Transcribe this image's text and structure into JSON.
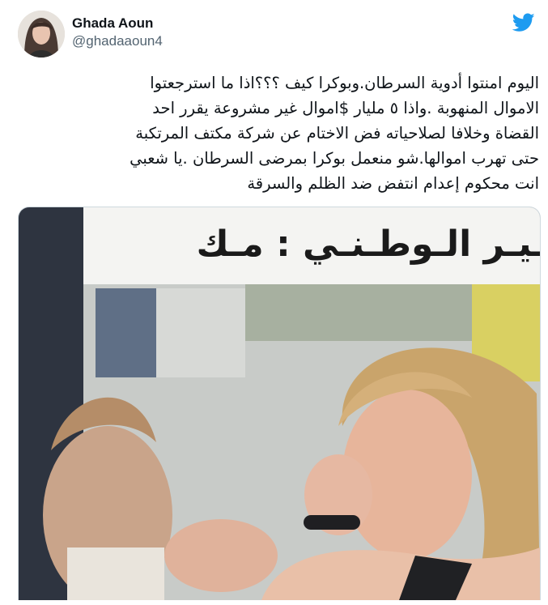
{
  "author": {
    "display_name": "Ghada Aoun",
    "handle": "@ghadaaoun4"
  },
  "icons": {
    "brand": "twitter-bird-icon",
    "brand_color": "#1d9bf0"
  },
  "tweet": {
    "lines": [
      "اليوم امنتوا أدوية السرطان.وبوكرا كيف ؟؟؟اذا ما استرجعتوا",
      "الاموال المنهوبة .واذا ٥ مليار $اموال غير مشروعة يقرر احد",
      "القضاة وخلافا لصلاحياته فض الاختام عن شركة مكتف المرتكبة",
      "حتى تهرب اموالها.شو منعمل بوكرا بمرضى السرطان .يا شعبي",
      "انت محكوم إعدام انتفض ضد الظلم والسرقة"
    ]
  },
  "media": {
    "caption_text": "ـيـر الـوطـنـي : مـك"
  }
}
